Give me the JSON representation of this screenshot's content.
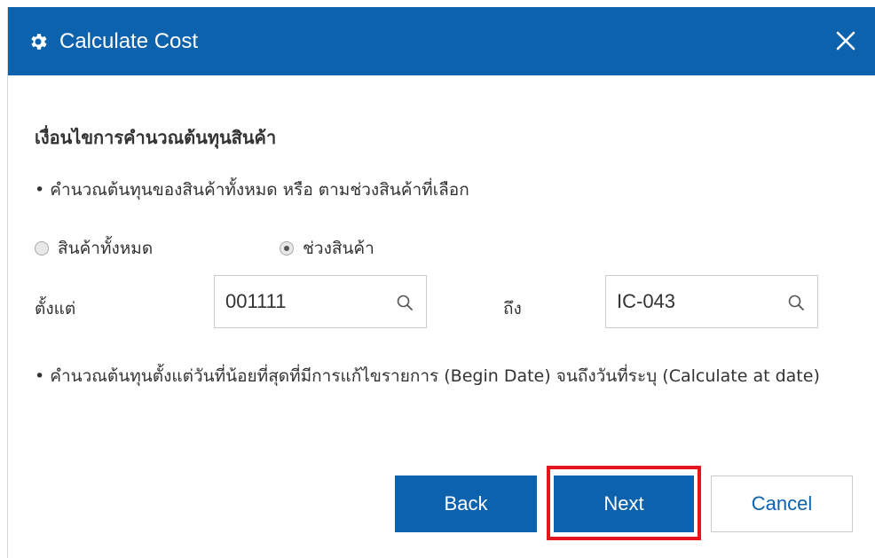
{
  "dialog": {
    "title": "Calculate Cost",
    "section_title": "เงื่อนไขการคำนวณต้นทุนสินค้า",
    "bullet1": "• คำนวณต้นทุนของสินค้าทั้งหมด หรือ ตามช่วงสินค้าที่เลือก",
    "radios": [
      {
        "label": "สินค้าทั้งหมด",
        "checked": false
      },
      {
        "label": "ช่วงสินค้า",
        "checked": true
      }
    ],
    "range": {
      "from_label": "ตั้งแต่",
      "from_value": "001111",
      "to_label": "ถึง",
      "to_value": "IC-043"
    },
    "bullet2": "• คำนวณต้นทุนตั้งแต่วันที่น้อยที่สุดที่มีการแก้ไขรายการ (Begin Date) จนถึงวันที่ระบุ (Calculate at date)",
    "buttons": {
      "back": "Back",
      "next": "Next",
      "cancel": "Cancel"
    }
  },
  "colors": {
    "primary": "#0d62ad",
    "highlight": "#e8141c"
  },
  "icons": {
    "title": "gear-icon",
    "close": "close-icon",
    "field": "search-icon"
  }
}
